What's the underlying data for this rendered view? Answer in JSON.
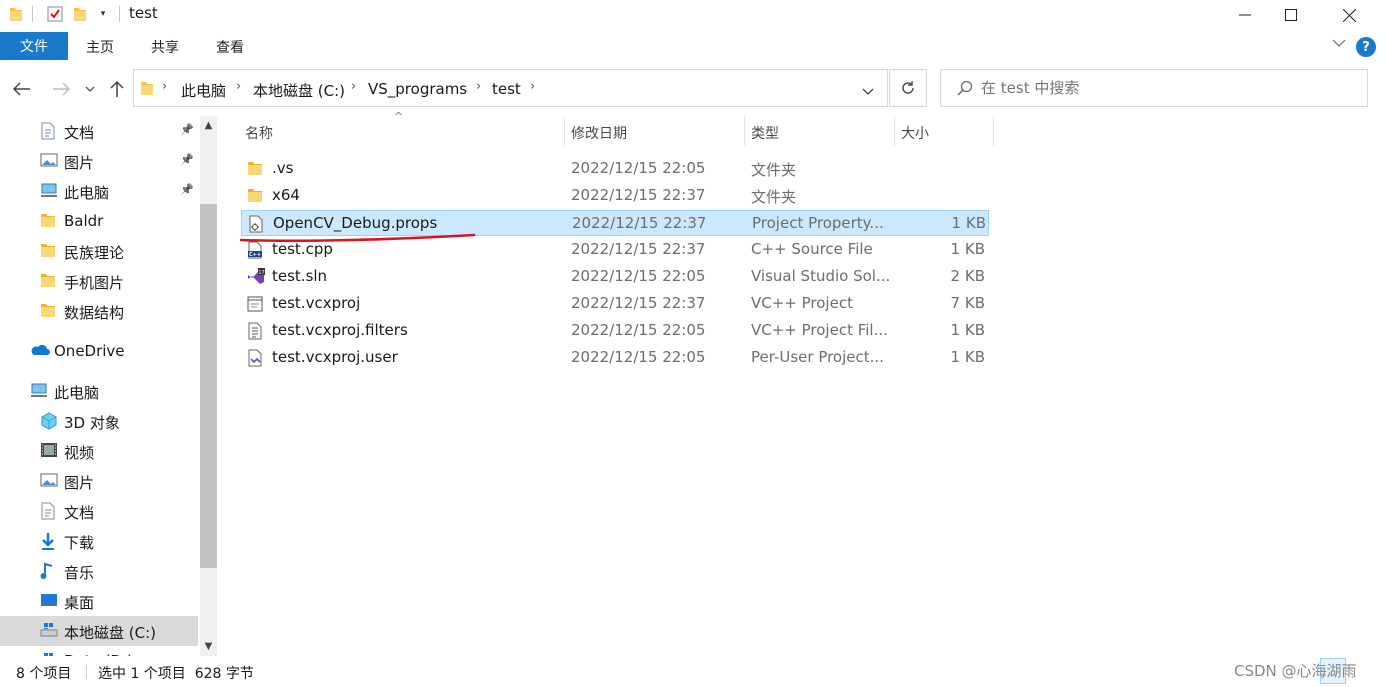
{
  "window": {
    "title": "test"
  },
  "ribbon": {
    "tabs": [
      "文件",
      "主页",
      "共享",
      "查看"
    ]
  },
  "address": {
    "crumbs": [
      "此电脑",
      "本地磁盘 (C:)",
      "VS_programs",
      "test"
    ]
  },
  "search": {
    "placeholder": "在 test 中搜索"
  },
  "sidebar": {
    "items": [
      {
        "label": "文档",
        "icon": "document-icon",
        "pinned": true
      },
      {
        "label": "图片",
        "icon": "pictures-icon",
        "pinned": true
      },
      {
        "label": "此电脑",
        "icon": "this-pc-icon",
        "pinned": true
      },
      {
        "label": "Baldr",
        "icon": "folder-icon"
      },
      {
        "label": "民族理论",
        "icon": "folder-icon"
      },
      {
        "label": "手机图片",
        "icon": "folder-icon"
      },
      {
        "label": "数据结构",
        "icon": "folder-icon"
      },
      {
        "label": "OneDrive",
        "icon": "onedrive-icon"
      },
      {
        "label": "此电脑",
        "icon": "this-pc-icon"
      },
      {
        "label": "3D 对象",
        "icon": "3d-objects-icon"
      },
      {
        "label": "视频",
        "icon": "videos-icon"
      },
      {
        "label": "图片",
        "icon": "pictures-icon"
      },
      {
        "label": "文档",
        "icon": "document-icon"
      },
      {
        "label": "下载",
        "icon": "downloads-icon"
      },
      {
        "label": "音乐",
        "icon": "music-icon"
      },
      {
        "label": "桌面",
        "icon": "desktop-icon"
      },
      {
        "label": "本地磁盘 (C:)",
        "icon": "drive-icon",
        "selected": true
      },
      {
        "label": "Data (D:)",
        "icon": "drive-icon"
      }
    ]
  },
  "columns": {
    "name": "名称",
    "modified": "修改日期",
    "type": "类型",
    "size": "大小"
  },
  "files": [
    {
      "name": ".vs",
      "modified": "2022/12/15 22:05",
      "type": "文件夹",
      "size": "",
      "icon": "folder-icon"
    },
    {
      "name": "x64",
      "modified": "2022/12/15 22:37",
      "type": "文件夹",
      "size": "",
      "icon": "folder-icon"
    },
    {
      "name": "OpenCV_Debug.props",
      "modified": "2022/12/15 22:37",
      "type": "Project Property...",
      "size": "1 KB",
      "icon": "props-file-icon",
      "selected": true
    },
    {
      "name": "test.cpp",
      "modified": "2022/12/15 22:37",
      "type": "C++ Source File",
      "size": "1 KB",
      "icon": "cpp-file-icon"
    },
    {
      "name": "test.sln",
      "modified": "2022/12/15 22:05",
      "type": "Visual Studio Sol...",
      "size": "2 KB",
      "icon": "sln-file-icon"
    },
    {
      "name": "test.vcxproj",
      "modified": "2022/12/15 22:37",
      "type": "VC++ Project",
      "size": "7 KB",
      "icon": "vcxproj-file-icon"
    },
    {
      "name": "test.vcxproj.filters",
      "modified": "2022/12/15 22:05",
      "type": "VC++ Project Fil...",
      "size": "1 KB",
      "icon": "filters-file-icon"
    },
    {
      "name": "test.vcxproj.user",
      "modified": "2022/12/15 22:05",
      "type": "Per-User Project...",
      "size": "1 KB",
      "icon": "user-file-icon"
    }
  ],
  "status": {
    "count": "8 个项目",
    "selection": "选中 1 个项目  628 字节"
  },
  "watermark": "CSDN @心海湖雨",
  "colors": {
    "accent": "#1979ca",
    "selection": "#cce8ff",
    "folder": "#f5c242",
    "annotation": "#d9141a"
  }
}
